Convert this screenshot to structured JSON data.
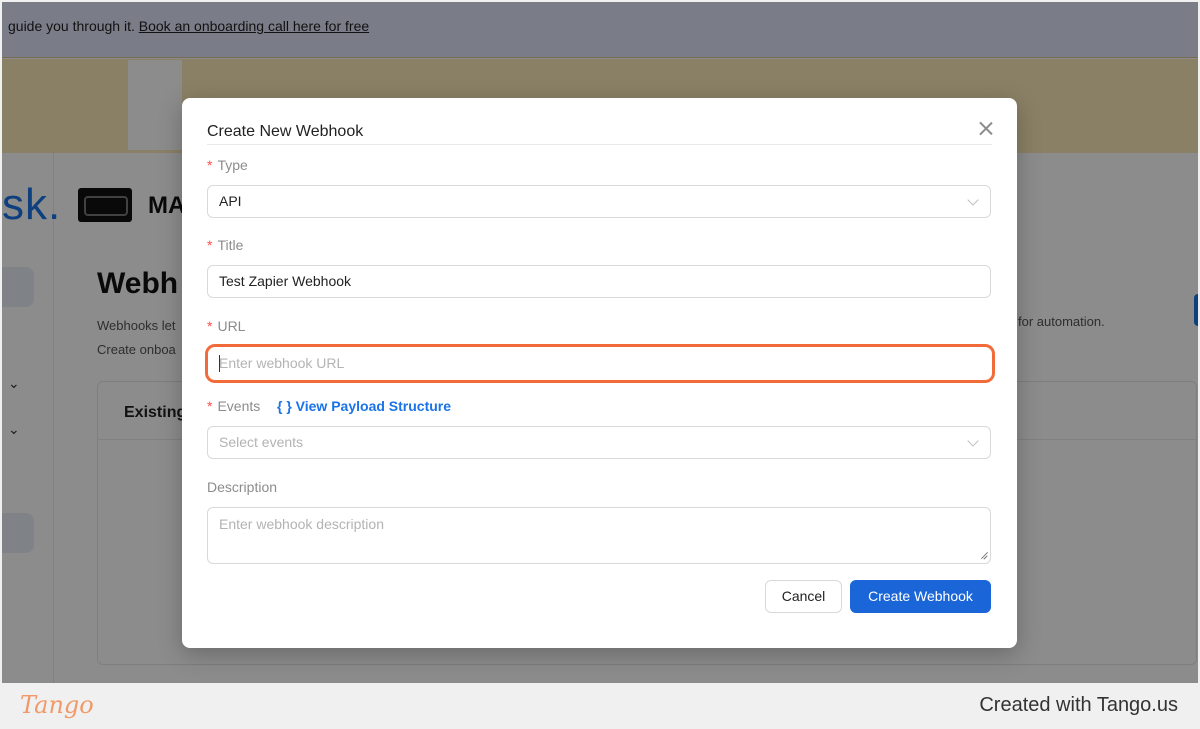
{
  "banner": {
    "text": "guide you through it. ",
    "link": "Book an onboarding call here for free"
  },
  "background": {
    "brand_text": "sk.",
    "org_name": "MA",
    "page_title": "Webh",
    "desc_line1": "Webhooks let",
    "desc_line2": "Create onboa",
    "desc_right": "for automation.",
    "card_title": "Existing",
    "sidebar_chevrons": [
      "⌄",
      "⌄"
    ]
  },
  "modal": {
    "title": "Create New Webhook",
    "required_mark": "*",
    "fields": {
      "type": {
        "label": "Type",
        "value": "API"
      },
      "title": {
        "label": "Title",
        "value": "Test Zapier Webhook"
      },
      "url": {
        "label": "URL",
        "placeholder": "Enter webhook URL",
        "value": ""
      },
      "events": {
        "label": "Events",
        "link": "{ } View Payload Structure",
        "placeholder": "Select events"
      },
      "description": {
        "label": "Description",
        "placeholder": "Enter webhook description"
      }
    },
    "buttons": {
      "cancel": "Cancel",
      "create": "Create Webhook"
    }
  },
  "footer": {
    "logo": "Tango",
    "credit": "Created with Tango.us"
  },
  "colors": {
    "accent": "#1a66d9",
    "highlight": "#f26b3a",
    "required": "#ff4d4f",
    "overlay": "rgba(0,0,0,0.45)"
  }
}
